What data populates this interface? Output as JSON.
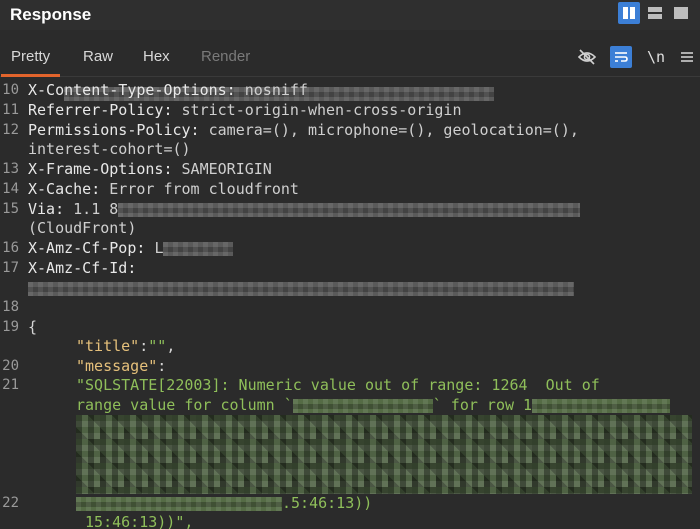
{
  "header": {
    "title": "Response"
  },
  "tabs": [
    {
      "label": "Pretty",
      "active": true
    },
    {
      "label": "Raw"
    },
    {
      "label": "Hex"
    },
    {
      "label": "Render",
      "disabled": true
    }
  ],
  "toolbar": {
    "newline_label": "\\n",
    "icons": [
      "eye-off-icon",
      "wrap-icon",
      "newline-icon",
      "menu-icon"
    ]
  },
  "lines": {
    "l10_num": "10",
    "l10_key": "X-Content-Type-Options:",
    "l10_val": "nosniff",
    "l11_num": "11",
    "l11_key": "Referrer-Policy:",
    "l11_val": "strict-origin-when-cross-origin",
    "l12_num": "12",
    "l12_key": "Permissions-Policy:",
    "l12_val": "camera=(), microphone=(), geolocation=(),",
    "l12_val2": "interest-cohort=()",
    "l13_num": "13",
    "l13_key": "X-Frame-Options:",
    "l13_val": "SAMEORIGIN",
    "l14_num": "14",
    "l14_key": "X-Cache:",
    "l14_val": "Error from cloudfront",
    "l15_num": "15",
    "l15_key": "Via:",
    "l15_val": "1.1 8",
    "l15_val2": "(CloudFront)",
    "l16_num": "16",
    "l16_key": "X-Amz-Cf-Pop:",
    "l16_val": "L",
    "l17_num": "17",
    "l17_key": "X-Amz-Cf-Id:",
    "l18_num": "18",
    "l19_num": "19",
    "l19_brace": "{",
    "l20_num": "20",
    "title_key": "\"title\"",
    "title_colon": ":",
    "title_val": "\"\"",
    "title_comma": ",",
    "message_key": "\"message\"",
    "message_colon": ":",
    "l21_num": "21",
    "msg_line1": "\"SQLSTATE[22003]: Numeric value out of range: 1264  Out of",
    "msg_line2a": "range value for column `",
    "msg_line2b": "` for row 1",
    "l22_num": "22",
    "msg_tail1": ".5:46:13))",
    "msg_tail2": " 15:46:13))\","
  }
}
